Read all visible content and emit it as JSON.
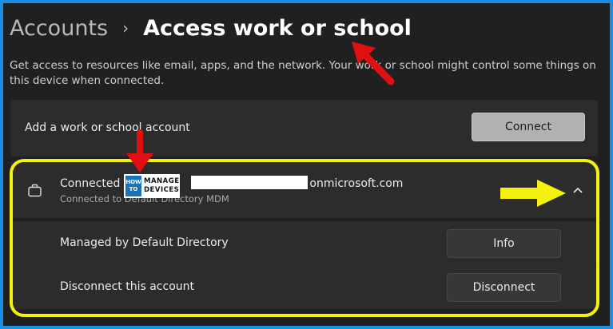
{
  "header": {
    "breadcrumb_parent": "Accounts",
    "breadcrumb_separator": "›",
    "breadcrumb_current": "Access work or school"
  },
  "description": "Get access to resources like email, apps, and the network. Your work or school might control some things on this device when connected.",
  "add_account": {
    "label": "Add a work or school account",
    "button": "Connect"
  },
  "account": {
    "title_prefix": "Connected",
    "title_suffix": "onmicrosoft.com",
    "subtitle": "Connected to Default Directory MDM",
    "icon": "briefcase-icon",
    "expanded_icon": "chevron-up-icon"
  },
  "rows": [
    {
      "label": "Managed by Default Directory",
      "button": "Info"
    },
    {
      "label": "Disconnect this account",
      "button": "Disconnect"
    }
  ],
  "watermark": {
    "line1": "HOW",
    "line2": "TO",
    "line3": "MANAGE",
    "line4": "DEVICES"
  },
  "colors": {
    "background": "#202020",
    "card": "#2c2c2c",
    "border": "#1a8fe3",
    "highlight": "#f5f10f",
    "annotation_arrow": "#e01010"
  }
}
